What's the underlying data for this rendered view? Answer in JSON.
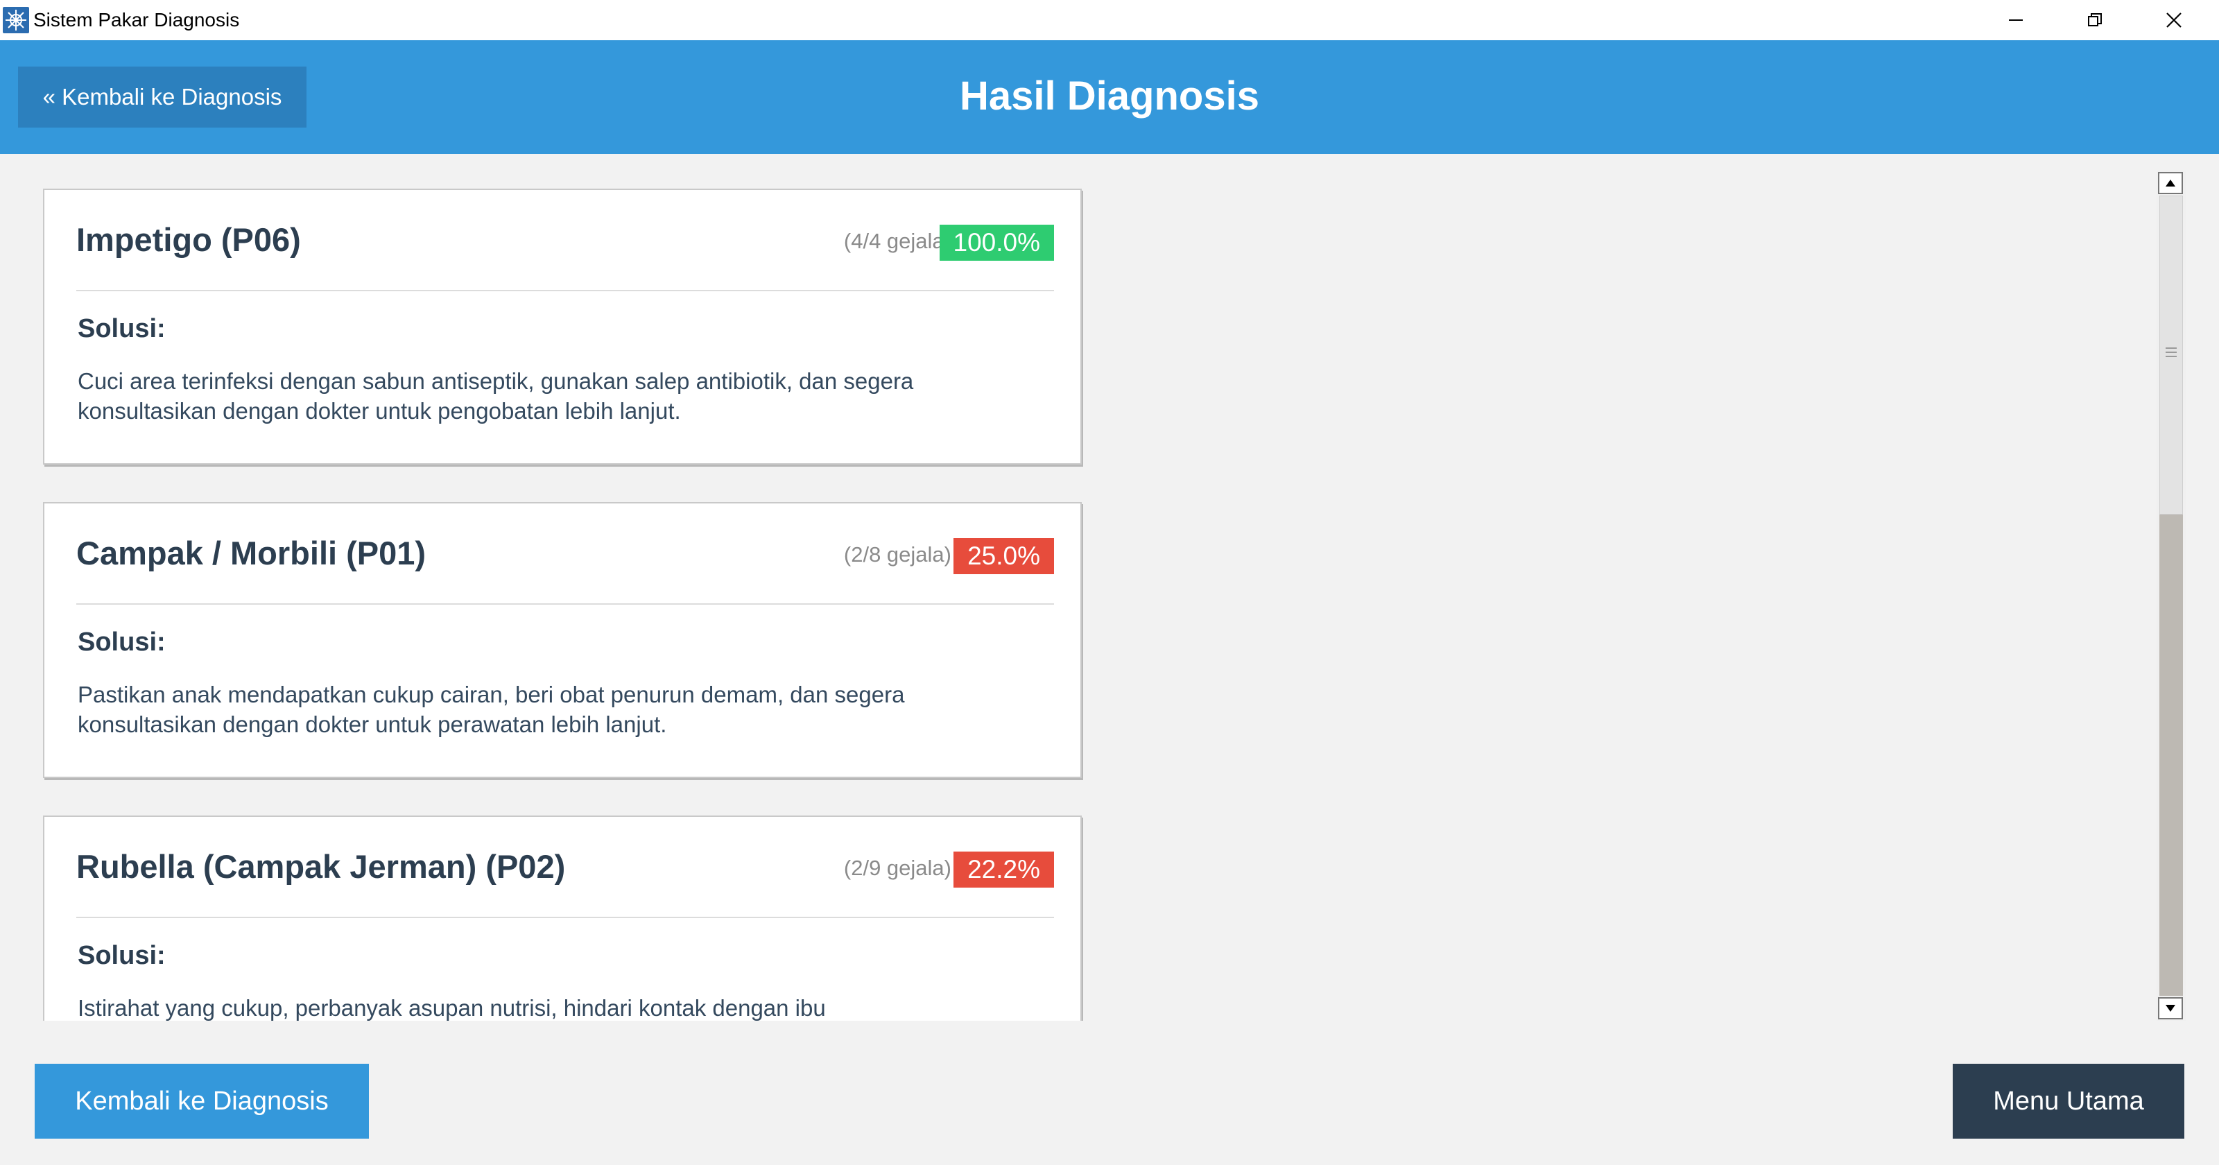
{
  "window": {
    "title": "Sistem Pakar Diagnosis",
    "app_icon": "app-logo-icon",
    "controls": [
      "minimize-icon",
      "restore-icon",
      "close-icon"
    ]
  },
  "header": {
    "back_button_label": "« Kembali ke Diagnosis",
    "title": "Hasil Diagnosis",
    "background_color": "#3498db"
  },
  "results": [
    {
      "title": "Impetigo (P06)",
      "count": "(4/4 gejala)",
      "percent": "100.0%",
      "badge_color": "#2ecc71",
      "solusi_label": "Solusi:",
      "solusi_text": "Cuci area terinfeksi dengan sabun antiseptik, gunakan salep antibiotik, dan segera konsultasikan dengan dokter untuk pengobatan lebih lanjut."
    },
    {
      "title": "Campak / Morbili (P01)",
      "count": "(2/8 gejala)",
      "percent": "25.0%",
      "badge_color": "#e74c3c",
      "solusi_label": "Solusi:",
      "solusi_text": "Pastikan anak mendapatkan cukup cairan, beri obat penurun demam, dan segera konsultasikan dengan dokter untuk perawatan lebih lanjut."
    },
    {
      "title": "Rubella (Campak Jerman) (P02)",
      "count": "(2/9 gejala)",
      "percent": "22.2%",
      "badge_color": "#e74c3c",
      "solusi_label": "Solusi:",
      "solusi_text": "Istirahat yang cukup, perbanyak asupan nutrisi, hindari kontak dengan ibu"
    }
  ],
  "footer": {
    "back_button_label": "Kembali ke Diagnosis",
    "main_menu_label": "Menu Utama"
  }
}
